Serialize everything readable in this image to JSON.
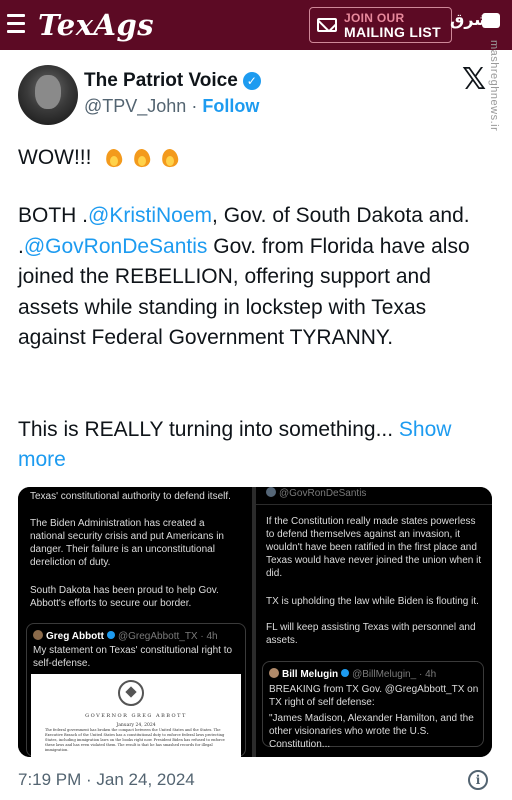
{
  "site": {
    "logo": "TexAgs",
    "mailing": {
      "line1": "JOIN OUR",
      "line2": "MAILING LIST"
    },
    "watermark": "مشرق",
    "side_watermark": "mashreghnews.ir"
  },
  "tweet": {
    "author_name": "The Patriot Voice",
    "handle": "@TPV_John",
    "separator": " · ",
    "follow": "Follow",
    "wow": "WOW!!!",
    "line_a": "BOTH .",
    "mention1": "@KristiNoem",
    "line_b": ", Gov. of South Dakota and. .",
    "mention2": "@GovRonDeSantis",
    "line_c": " Gov. from Florida have also joined the REBELLION, offering support and assets while standing in lockstep with Texas against Federal Government TYRANNY.",
    "line_d": "This is REALLY turning into something... ",
    "show_more": "Show more",
    "timestamp": "7:19 PM · Jan 24, 2024"
  },
  "left_panel": {
    "text1": "Texas' constitutional authority to defend itself.",
    "text2": "The Biden Administration has created a national security crisis and put Americans in danger. Their failure is an unconstitutional dereliction of duty.",
    "text3": "South Dakota has been proud to help Gov. Abbott's efforts to secure our border.",
    "quote_name": "Greg Abbott",
    "quote_handle": "@GregAbbott_TX · 4h",
    "quote_text": "My statement on Texas' constitutional right to self-defense.",
    "doc_title": "GOVERNOR GREG ABBOTT",
    "doc_date": "January 24, 2024",
    "doc_body": "The federal government has broken the compact between the United States and the States. The Executive Branch of the United States has a constitutional duty to enforce federal laws protecting States, including immigration laws on the books right now. President Biden has refused to enforce these laws and has even violated them. The result is that he has smashed records for illegal immigration."
  },
  "right_panel": {
    "top_handle": "@GovRonDeSantis",
    "text1": "If the Constitution really made states powerless to defend themselves against an invasion, it wouldn't have been ratified in the first place and Texas would have never joined the union when it did.",
    "text2": "TX is upholding the law while Biden is flouting it.",
    "text3": "FL will keep assisting Texas with personnel and assets.",
    "quote_name": "Bill Melugin",
    "quote_handle": "@BillMelugin_ · 4h",
    "quote_text": "BREAKING from TX Gov. @GregAbbott_TX on TX right of self defense:",
    "quote_text2": "\"James Madison, Alexander Hamilton, and the other visionaries who wrote the U.S. Constitution..."
  },
  "icons": [
    "hamburger-icon",
    "mail-icon",
    "chat-icon",
    "verified-badge-icon",
    "x-logo-icon",
    "fire-emoji-icon",
    "info-icon",
    "seal-icon"
  ],
  "colors": {
    "header_bg": "#5c0a24",
    "link": "#1d9bf0",
    "text": "#0f1419",
    "muted": "#536471"
  }
}
